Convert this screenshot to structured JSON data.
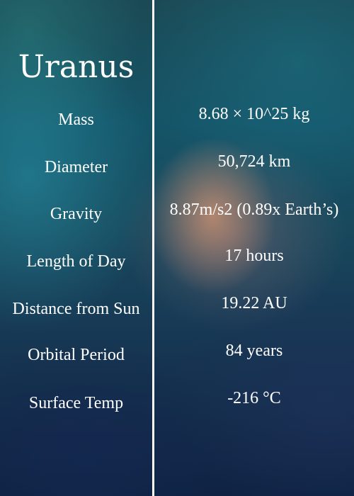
{
  "title": "Uranus",
  "facts": [
    {
      "label": "Mass",
      "value": "8.68 × 10^25 kg"
    },
    {
      "label": "Diameter",
      "value": "50,724 km"
    },
    {
      "label": "Gravity",
      "value": "8.87m/s2 (0.89x Earth’s)"
    },
    {
      "label": "Length of Day",
      "value": "17 hours"
    },
    {
      "label": "Distance from Sun",
      "value": "19.22 AU"
    },
    {
      "label": "Orbital Period",
      "value": "84 years"
    },
    {
      "label": "Surface Temp",
      "value": "-216 °C"
    }
  ]
}
